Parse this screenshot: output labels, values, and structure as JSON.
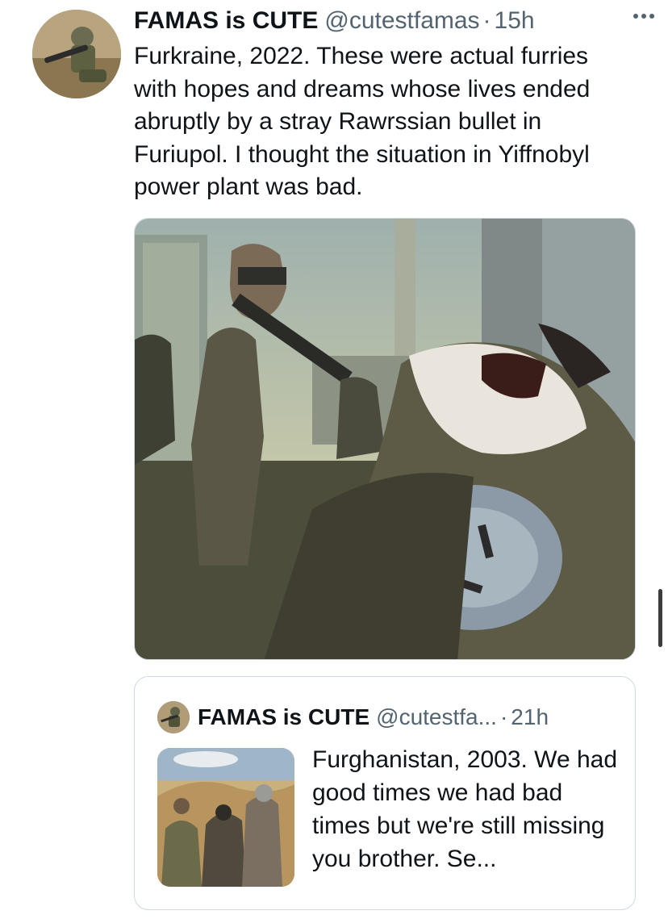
{
  "tweet": {
    "author": {
      "display_name": "FAMAS is CUTE",
      "handle": "@cutestfamas",
      "separator": "·",
      "time": "15h"
    },
    "more_icon": "more-horizontal-icon",
    "text": "Furkraine, 2022. These were actual furries\nwith hopes and dreams whose lives ended\nabruptly by a stray Rawrssian bullet in\nFuriupol. I thought the situation in Yiffnobyl\npower plant was bad.",
    "media": {
      "kind": "illustration"
    }
  },
  "quoted_tweet": {
    "author": {
      "display_name": "FAMAS is CUTE",
      "handle": "@cutestfa...",
      "separator": "·",
      "time": "21h"
    },
    "text": "Furghanistan, 2003. We had good times we had bad times but we're still missing you brother. Se...",
    "media": {
      "kind": "thumbnail"
    }
  },
  "colors": {
    "text_primary": "#0f1419",
    "text_secondary": "#536471",
    "border": "#cfd9de",
    "background": "#ffffff"
  }
}
